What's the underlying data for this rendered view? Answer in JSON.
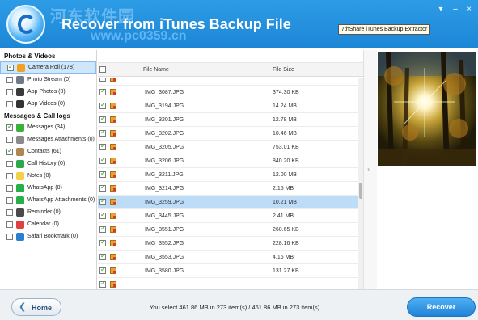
{
  "header": {
    "title": "Recover from iTunes Backup File",
    "watermark_top": "河东软件园",
    "watermark_url": "www.pc0359.cn",
    "tooltip": "7thShare iTunes Backup Extractor",
    "minimize_glyph": "–",
    "close_glyph": "×",
    "menu_glyph": "▾"
  },
  "sidebar": {
    "sections": [
      {
        "title": "Photos & Videos",
        "items": [
          {
            "label": "Camera Roll (178)",
            "checked": true,
            "selected": true,
            "icon": "camera-roll-icon",
            "color": "#f0a21e"
          },
          {
            "label": "Photo Stream (0)",
            "checked": false,
            "selected": false,
            "icon": "photo-stream-icon",
            "color": "#6f7a85"
          },
          {
            "label": "App Photos (0)",
            "checked": false,
            "selected": false,
            "icon": "app-photos-icon",
            "color": "#3a3a3a"
          },
          {
            "label": "App Videos (0)",
            "checked": false,
            "selected": false,
            "icon": "app-videos-icon",
            "color": "#333333"
          }
        ]
      },
      {
        "title": "Messages & Call logs",
        "items": [
          {
            "label": "Messages (34)",
            "checked": true,
            "selected": false,
            "icon": "messages-icon",
            "color": "#3ab13a"
          },
          {
            "label": "Messages Attachments (0)",
            "checked": false,
            "selected": false,
            "icon": "messages-attachments-icon",
            "color": "#8a8a8a"
          },
          {
            "label": "Contacts (61)",
            "checked": true,
            "selected": false,
            "icon": "contacts-icon",
            "color": "#b08650"
          },
          {
            "label": "Call History (0)",
            "checked": false,
            "selected": false,
            "icon": "call-history-icon",
            "color": "#2aa84a"
          },
          {
            "label": "Notes (0)",
            "checked": false,
            "selected": false,
            "icon": "notes-icon",
            "color": "#f2d04a"
          },
          {
            "label": "WhatsApp (0)",
            "checked": false,
            "selected": false,
            "icon": "whatsapp-icon",
            "color": "#27b04a"
          },
          {
            "label": "WhatsApp Attachments (0)",
            "checked": false,
            "selected": false,
            "icon": "whatsapp-attachments-icon",
            "color": "#27b04a"
          },
          {
            "label": "Reminder (0)",
            "checked": false,
            "selected": false,
            "icon": "reminder-icon",
            "color": "#4a4a4a"
          },
          {
            "label": "Calendar (0)",
            "checked": false,
            "selected": false,
            "icon": "calendar-icon",
            "color": "#e04040"
          },
          {
            "label": "Safari Bookmark (0)",
            "checked": false,
            "selected": false,
            "icon": "safari-bookmark-icon",
            "color": "#2a7fd0"
          }
        ]
      }
    ]
  },
  "table": {
    "columns": {
      "name": "File Name",
      "size": "File Size"
    },
    "rows": [
      {
        "name": "",
        "size": "",
        "checked": true,
        "selected": false
      },
      {
        "name": "IMG_3087.JPG",
        "size": "374.30 KB",
        "checked": true,
        "selected": false
      },
      {
        "name": "IMG_3194.JPG",
        "size": "14.24 MB",
        "checked": true,
        "selected": false
      },
      {
        "name": "IMG_3201.JPG",
        "size": "12.78 MB",
        "checked": true,
        "selected": false
      },
      {
        "name": "IMG_3202.JPG",
        "size": "10.46 MB",
        "checked": true,
        "selected": false
      },
      {
        "name": "IMG_3205.JPG",
        "size": "753.01 KB",
        "checked": true,
        "selected": false
      },
      {
        "name": "IMG_3206.JPG",
        "size": "840.20 KB",
        "checked": true,
        "selected": false
      },
      {
        "name": "IMG_3211.JPG",
        "size": "12.00 MB",
        "checked": true,
        "selected": false
      },
      {
        "name": "IMG_3214.JPG",
        "size": "2.15 MB",
        "checked": true,
        "selected": false
      },
      {
        "name": "IMG_3259.JPG",
        "size": "10.21 MB",
        "checked": true,
        "selected": true
      },
      {
        "name": "IMG_3445.JPG",
        "size": "2.41 MB",
        "checked": true,
        "selected": false
      },
      {
        "name": "IMG_3551.JPG",
        "size": "260.65 KB",
        "checked": true,
        "selected": false
      },
      {
        "name": "IMG_3552.JPG",
        "size": "228.16 KB",
        "checked": true,
        "selected": false
      },
      {
        "name": "IMG_3553.JPG",
        "size": "4.16 MB",
        "checked": true,
        "selected": false
      },
      {
        "name": "IMG_3580.JPG",
        "size": "131.27 KB",
        "checked": true,
        "selected": false
      },
      {
        "name": "",
        "size": "",
        "checked": true,
        "selected": false
      }
    ]
  },
  "footer": {
    "home_label": "Home",
    "status": "You select 461.86 MB in 273 item(s) / 461.86 MB in 273 item(s)",
    "recover_label": "Recover"
  },
  "colors": {
    "header_blue": "#1f8ad9",
    "selection_blue": "#bcdcf7",
    "check_green": "#1e9a1e"
  }
}
